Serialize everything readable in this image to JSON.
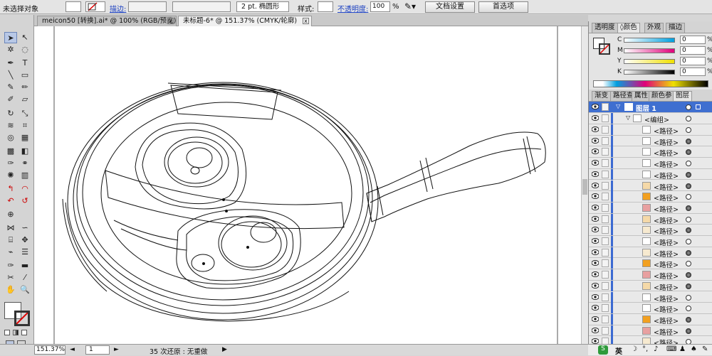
{
  "control_bar": {
    "selection": "未选择对象",
    "stroke_label": "描边:",
    "stroke_weight": "2 pt. 椭圆形",
    "style_label": "样式:",
    "opacity_label": "不透明度:",
    "opacity_value": "100",
    "opacity_unit": "%",
    "doc_setup": "文档设置",
    "preferences": "首选项"
  },
  "tabs": [
    {
      "label": "meicon50 [转换].ai* @ 100% (RGB/预览)",
      "close": "x"
    },
    {
      "label": "未标题-6* @ 151.37% (CMYK/轮廓)",
      "close": "x"
    }
  ],
  "status_bar": {
    "zoom": "151.37%",
    "artboard": "1",
    "undo_info": "35 次还原 : 无重做"
  },
  "color_panel": {
    "tabs": [
      "透明度",
      "颜色",
      "外观",
      "描边"
    ],
    "active_tab": "颜色",
    "channels": [
      {
        "label": "C",
        "value": "0",
        "color": "#00a0e0"
      },
      {
        "label": "M",
        "value": "0",
        "color": "#e0007a"
      },
      {
        "label": "Y",
        "value": "0",
        "color": "#f0e000"
      },
      {
        "label": "K",
        "value": "0",
        "color": "#000000"
      }
    ],
    "unit": "%"
  },
  "layers_panel": {
    "tabs": [
      "渐变",
      "路径查",
      "属性",
      "颜色参",
      "图层"
    ],
    "active_tab": "图层",
    "layer_name": "图层 1",
    "group_name": "<编组>",
    "rows": [
      {
        "name": "<路径>",
        "thumb": "#ffffff",
        "target_filled": false
      },
      {
        "name": "<路径>",
        "thumb": "#ffffff",
        "target_filled": true
      },
      {
        "name": "<路径>",
        "thumb": "#ffffff",
        "target_filled": true
      },
      {
        "name": "<路径>",
        "thumb": "#ffffff",
        "target_filled": false
      },
      {
        "name": "<路径>",
        "thumb": "#ffffff",
        "target_filled": true
      },
      {
        "name": "<路径>",
        "thumb": "#f5d9a8",
        "target_filled": true
      },
      {
        "name": "<路径>",
        "thumb": "#f2a020",
        "target_filled": false
      },
      {
        "name": "<路径>",
        "thumb": "#e8a0a0",
        "target_filled": true
      },
      {
        "name": "<路径>",
        "thumb": "#f5d9a8",
        "target_filled": false
      },
      {
        "name": "<路径>",
        "thumb": "#f7ead0",
        "target_filled": true
      },
      {
        "name": "<路径>",
        "thumb": "#ffffff",
        "target_filled": false
      },
      {
        "name": "<路径>",
        "thumb": "#f7ead0",
        "target_filled": true
      },
      {
        "name": "<路径>",
        "thumb": "#f2a020",
        "target_filled": false
      },
      {
        "name": "<路径>",
        "thumb": "#e8a0a0",
        "target_filled": true
      },
      {
        "name": "<路径>",
        "thumb": "#f5d9a8",
        "target_filled": true
      },
      {
        "name": "<路径>",
        "thumb": "#ffffff",
        "target_filled": false
      },
      {
        "name": "<路径>",
        "thumb": "#ffffff",
        "target_filled": false
      },
      {
        "name": "<路径>",
        "thumb": "#f2a020",
        "target_filled": true
      },
      {
        "name": "<路径>",
        "thumb": "#e8a0a0",
        "target_filled": true
      },
      {
        "name": "<路径>",
        "thumb": "#f7ead0",
        "target_filled": false
      }
    ]
  },
  "taskbar": {
    "ime": "英"
  }
}
